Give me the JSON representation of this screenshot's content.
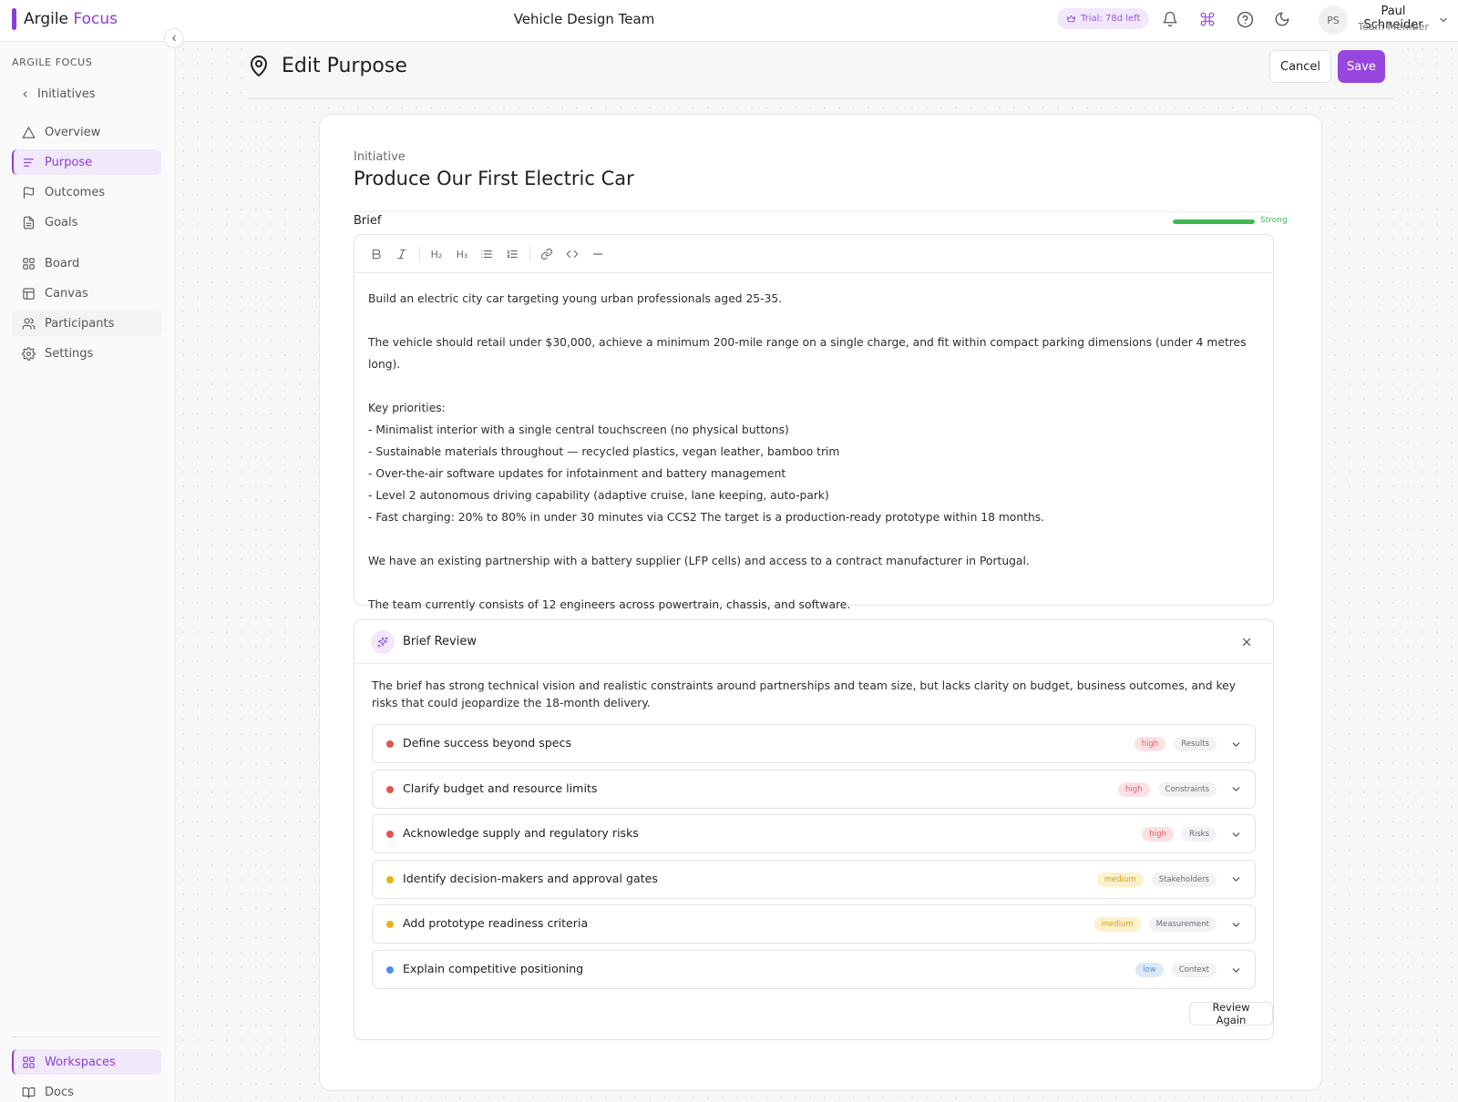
{
  "brand": {
    "name_part1": "Argile",
    "name_part2": "Focus",
    "accent": "#8b3dd8"
  },
  "header": {
    "team_title": "Vehicle Design Team",
    "trial_label": "Trial: 78d left",
    "icons": [
      "bell-icon",
      "command-icon",
      "help-icon",
      "moon-icon"
    ],
    "user": {
      "initials": "PS",
      "name": "Paul Schneider",
      "role": "Team Member"
    }
  },
  "sidebar": {
    "heading": "ARGILE FOCUS",
    "back_label": "Initiatives",
    "items": [
      {
        "label": "Overview",
        "icon": "triangle-icon"
      },
      {
        "label": "Purpose",
        "icon": "lines-icon",
        "active": true
      },
      {
        "label": "Outcomes",
        "icon": "flag-icon"
      },
      {
        "label": "Goals",
        "icon": "document-icon"
      },
      {
        "label": "Board",
        "icon": "grid-icon"
      },
      {
        "label": "Canvas",
        "icon": "layout-icon"
      },
      {
        "label": "Participants",
        "icon": "users-icon"
      },
      {
        "label": "Settings",
        "icon": "gear-icon"
      }
    ],
    "footer_items": [
      {
        "label": "Workspaces",
        "icon": "grid-icon",
        "active": true
      },
      {
        "label": "Docs",
        "icon": "book-icon"
      }
    ]
  },
  "page": {
    "title": "Edit Purpose",
    "cancel_label": "Cancel",
    "save_label": "Save",
    "initiative_label": "Initiative",
    "initiative_title": "Produce Our First Electric Car",
    "brief_label": "Brief",
    "strength_label": "Strong",
    "strength_color": "#3fb950",
    "toolbar": {
      "bold": "B",
      "italic": "I",
      "h2": "H₂",
      "h3": "H₃",
      "icons": [
        "bold-icon",
        "italic-icon",
        "heading2-icon",
        "heading3-icon",
        "bullet-list-icon",
        "ordered-list-icon",
        "link-icon",
        "code-icon",
        "divider-icon"
      ]
    },
    "brief_paragraphs": [
      "Build an electric city car targeting young urban professionals aged 25-35.",
      "",
      "The vehicle should retail under $30,000, achieve a minimum 200-mile range on a single charge, and fit within compact parking dimensions (under 4 metres long).",
      "",
      "Key priorities:",
      "- Minimalist interior with a single central touchscreen (no physical buttons)",
      "- Sustainable materials throughout — recycled plastics, vegan leather, bamboo trim",
      "- Over-the-air software updates for infotainment and battery management",
      "- Level 2 autonomous driving capability (adaptive cruise, lane keeping, auto-park)",
      "- Fast charging: 20% to 80% in under 30 minutes via CCS2 The target is a production-ready prototype within 18 months.",
      "",
      "We have an existing partnership with a battery supplier (LFP cells) and access to a contract manufacturer in Portugal.",
      "",
      "The team currently consists of 12 engineers across powertrain, chassis, and software."
    ]
  },
  "review": {
    "title": "Brief Review",
    "summary": "The brief has strong technical vision and realistic constraints around partnerships and team size, but lacks clarity on budget, business outcomes, and key risks that could jeopardize the 18-month delivery.",
    "items": [
      {
        "text": "Define success beyond specs",
        "severity": "high",
        "category": "Results",
        "dot": "#e5534b"
      },
      {
        "text": "Clarify budget and resource limits",
        "severity": "high",
        "category": "Constraints",
        "dot": "#e5534b"
      },
      {
        "text": "Acknowledge supply and regulatory risks",
        "severity": "high",
        "category": "Risks",
        "dot": "#e5534b"
      },
      {
        "text": "Identify decision-makers and approval gates",
        "severity": "medium",
        "category": "Stakeholders",
        "dot": "#e5b310"
      },
      {
        "text": "Add prototype readiness criteria",
        "severity": "medium",
        "category": "Measurement",
        "dot": "#e5b310"
      },
      {
        "text": "Explain competitive positioning",
        "severity": "low",
        "category": "Context",
        "dot": "#4f8fe8"
      }
    ],
    "review_again_label": "Review Again"
  }
}
